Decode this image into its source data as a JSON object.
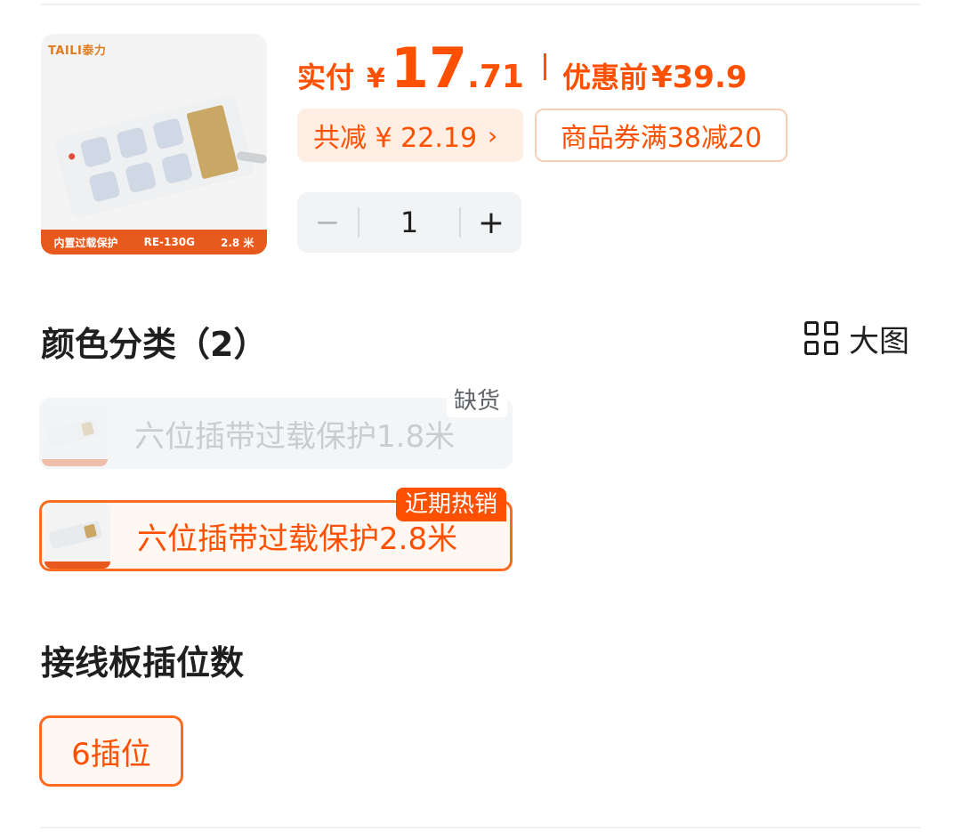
{
  "product": {
    "brand_logo": "TAILI泰力",
    "image_banner": [
      "内置过载保护",
      "RE-130G",
      "2.8 米"
    ]
  },
  "price": {
    "label": "实付",
    "currency": "¥",
    "integer": "17",
    "decimal": ".71",
    "original_label": "优惠前",
    "original_price": "¥39.9"
  },
  "savings": {
    "text": "共减 ¥ 22.19",
    "chevron": "›"
  },
  "coupon": {
    "text": "商品券满38减20"
  },
  "quantity": {
    "minus": "−",
    "value": "1",
    "plus": "+"
  },
  "color_section": {
    "title": "颜色分类（2）",
    "big_view_label": "大图",
    "big_view_icon": "grid-icon",
    "options": [
      {
        "label": "六位插带过载保护1.8米",
        "tag": "缺货",
        "state": "out-of-stock"
      },
      {
        "label": "六位插带过载保护2.8米",
        "tag": "近期热销",
        "state": "selected"
      }
    ]
  },
  "socket_section": {
    "title": "接线板插位数",
    "options": [
      {
        "label": "6插位",
        "state": "selected"
      }
    ]
  },
  "colors": {
    "accent": "#ff5000",
    "accent_border": "#ff6a1f",
    "save_bg": "#ffeee4"
  }
}
